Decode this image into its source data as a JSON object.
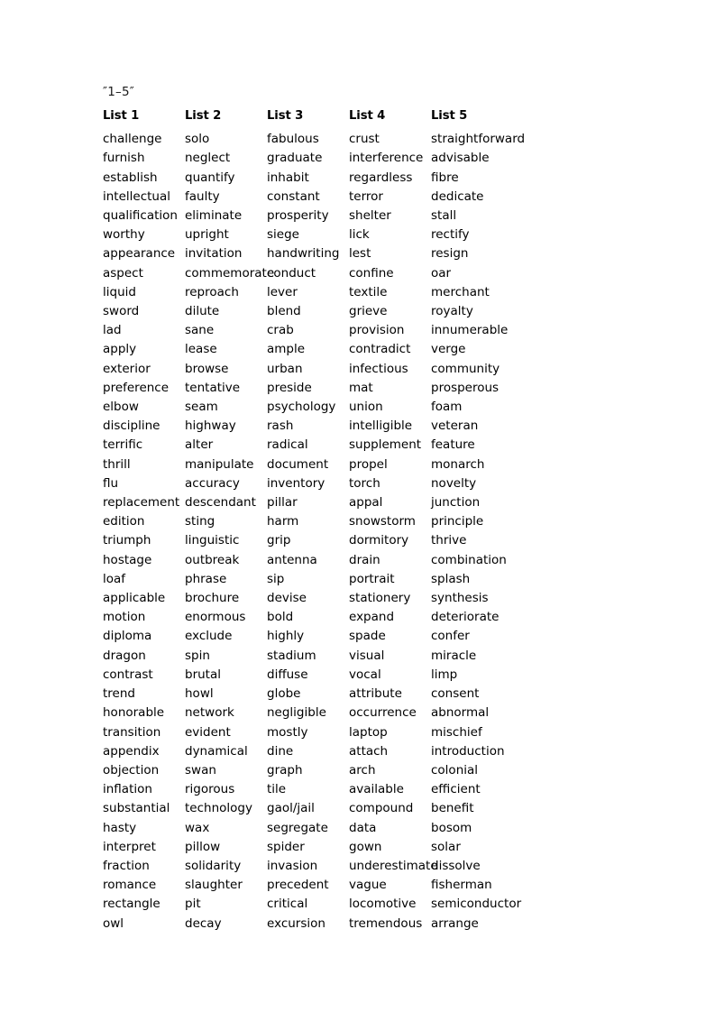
{
  "document": {
    "title": "″1–5″",
    "headers": [
      "List 1",
      "List 2",
      "List 3",
      "List 4",
      "List 5"
    ],
    "columns": [
      {
        "header": "List 1",
        "words": [
          "challenge",
          "furnish",
          "establish",
          "intellectual",
          "qualification",
          "worthy",
          "appearance",
          "aspect",
          "liquid",
          "sword",
          "lad",
          "apply",
          "exterior",
          "preference",
          "elbow",
          "discipline",
          "terrific",
          "thrill",
          "flu",
          "replacement",
          "edition",
          "triumph",
          "hostage",
          "loaf",
          "applicable",
          "motion",
          "diploma",
          "dragon",
          "contrast",
          "trend",
          "honorable",
          "transition",
          "appendix",
          "objection",
          "inflation",
          "substantial",
          "hasty",
          "interpret",
          "fraction",
          "romance",
          "rectangle",
          "owl"
        ]
      },
      {
        "header": "List 2",
        "words": [
          "solo",
          "neglect",
          "quantify",
          "faulty",
          "eliminate",
          "upright",
          "invitation",
          "commemorate",
          "reproach",
          "dilute",
          "sane",
          "lease",
          "browse",
          "tentative",
          "seam",
          "highway",
          "alter",
          "manipulate",
          "accuracy",
          "descendant",
          "sting",
          "linguistic",
          "outbreak",
          "phrase",
          "brochure",
          "enormous",
          "exclude",
          "spin",
          "brutal",
          "howl",
          "network",
          "evident",
          "dynamical",
          "swan",
          "rigorous",
          "technology",
          "wax",
          "pillow",
          "solidarity",
          "slaughter",
          "pit",
          "decay"
        ]
      },
      {
        "header": "List 3",
        "words": [
          "fabulous",
          "graduate",
          "inhabit",
          "constant",
          "prosperity",
          "siege",
          "handwriting",
          "conduct",
          "lever",
          "blend",
          "crab",
          "ample",
          "urban",
          "preside",
          "psychology",
          "rash",
          "radical",
          "document",
          "inventory",
          "pillar",
          "harm",
          "grip",
          "antenna",
          "sip",
          "devise",
          "bold",
          "highly",
          "stadium",
          "diffuse",
          "globe",
          "negligible",
          "mostly",
          "dine",
          "graph",
          "tile",
          "gaol/jail",
          "segregate",
          "spider",
          "invasion",
          "precedent",
          "critical",
          "excursion"
        ]
      },
      {
        "header": "List 4",
        "words": [
          "crust",
          "interference",
          "regardless",
          "terror",
          "shelter",
          "lick",
          "lest",
          "confine",
          "textile",
          "grieve",
          "provision",
          "contradict",
          "infectious",
          "mat",
          "union",
          "intelligible",
          "supplement",
          "propel",
          "torch",
          "appal",
          "snowstorm",
          "dormitory",
          "drain",
          "portrait",
          "stationery",
          "expand",
          "spade",
          "visual",
          "vocal",
          "attribute",
          "occurrence",
          "laptop",
          "attach",
          "arch",
          "available",
          "compound",
          "data",
          "gown",
          "underestimate",
          "vague",
          "locomotive",
          "tremendous"
        ]
      },
      {
        "header": "List 5",
        "words": [
          "straightforward",
          "advisable",
          "fibre",
          "dedicate",
          "stall",
          "rectify",
          "resign",
          "oar",
          "merchant",
          "royalty",
          "innumerable",
          "verge",
          "community",
          "prosperous",
          "foam",
          "veteran",
          "feature",
          "monarch",
          "novelty",
          "junction",
          "principle",
          "thrive",
          "combination",
          "splash",
          "synthesis",
          "deteriorate",
          "confer",
          "miracle",
          "limp",
          "consent",
          "abnormal",
          "mischief",
          "introduction",
          "colonial",
          "efficient",
          "benefit",
          "bosom",
          "solar",
          "dissolve",
          "fisherman",
          "semiconductor",
          "arrange"
        ]
      }
    ]
  }
}
